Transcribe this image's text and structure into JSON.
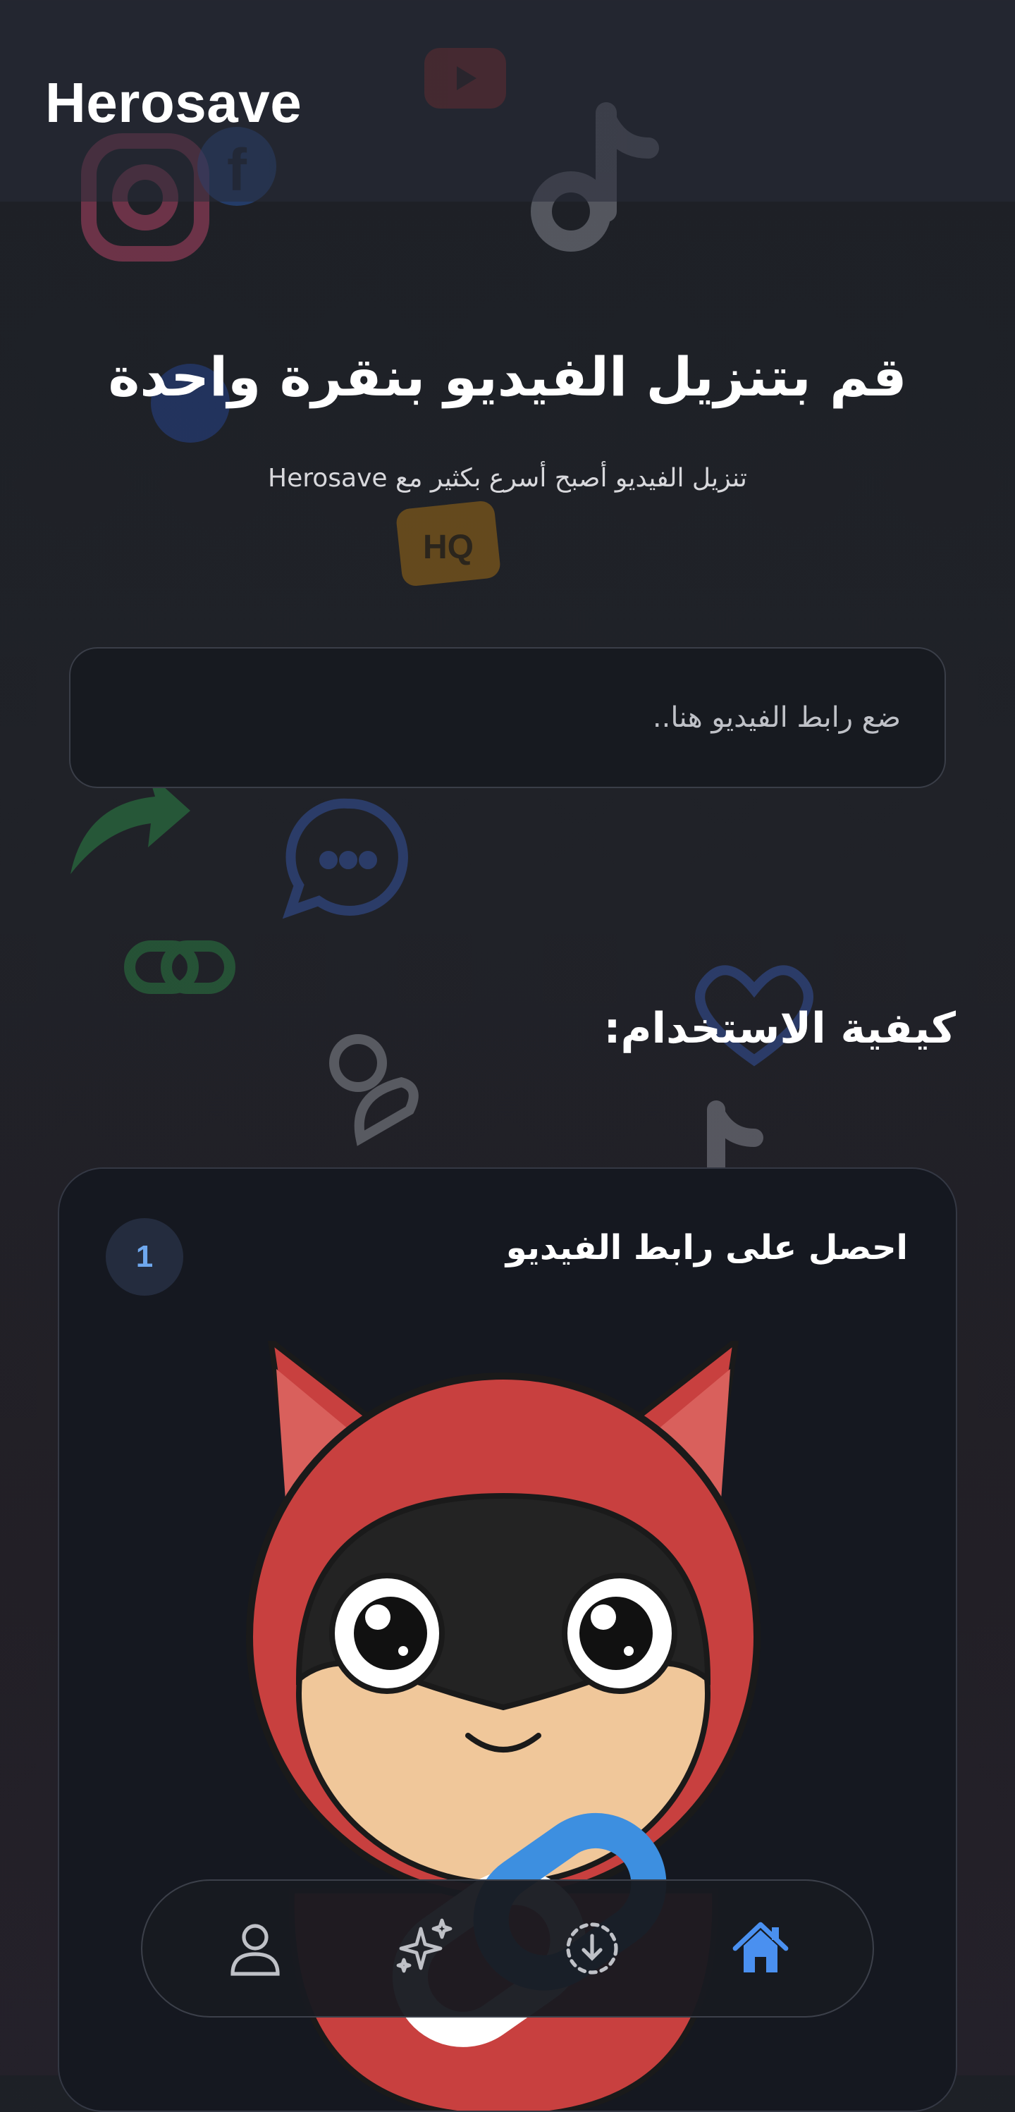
{
  "app": {
    "title": "Herosave"
  },
  "hero": {
    "title": "قم بتنزيل الفيديو بنقرة واحدة",
    "subtitle": "تنزيل الفيديو أصبح أسرع بكثير مع Herosave"
  },
  "url_input": {
    "placeholder": "ضع رابط الفيديو هنا.."
  },
  "how_to": {
    "title": "كيفية الاستخدام:",
    "steps": [
      {
        "number": "1",
        "title": "احصل على رابط الفيديو"
      }
    ]
  },
  "background_icons": [
    "youtube-icon",
    "tiktok-icon",
    "instagram-icon",
    "facebook-icon",
    "messenger-icon",
    "hq-icon",
    "share-icon",
    "chat-icon",
    "link-icon",
    "user-icon",
    "heart-icon"
  ],
  "bottom_nav": {
    "items": [
      {
        "icon": "user-icon",
        "active": false
      },
      {
        "icon": "sparkles-icon",
        "active": false
      },
      {
        "icon": "download-icon",
        "active": false
      },
      {
        "icon": "home-icon",
        "active": true
      }
    ]
  },
  "colors": {
    "accent": "#4a90f0",
    "background": "#1f2127",
    "card": "#151820",
    "mascot_red": "#c8403f",
    "mascot_mask": "#232323",
    "mascot_skin": "#f0c79a"
  }
}
